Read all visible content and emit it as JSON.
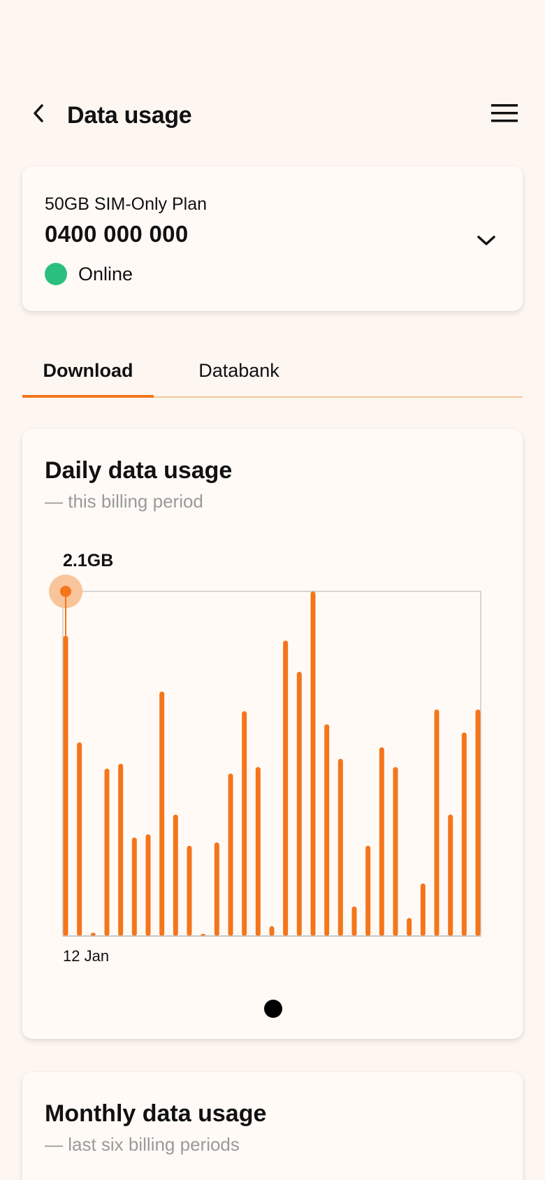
{
  "header": {
    "title": "Data usage",
    "back_icon": "chevron-left-icon",
    "menu_icon": "hamburger-menu-icon"
  },
  "service": {
    "plan": "50GB SIM-Only Plan",
    "number": "0400 000 000",
    "status": "Online",
    "status_color": "#2bbf7e",
    "expand_icon": "chevron-down-icon"
  },
  "tabs": [
    {
      "label": "Download",
      "active": true
    },
    {
      "label": "Databank",
      "active": false
    }
  ],
  "accent_color": "#f5751b",
  "daily": {
    "title": "Daily data usage",
    "subtitle": "— this billing period",
    "selected_value_label": "2.1GB",
    "start_label": "12 Jan"
  },
  "chart_data": {
    "type": "bar",
    "title": "Daily data usage",
    "subtitle": "— this billing period",
    "unit": "GB",
    "x_start_label": "12 Jan",
    "values": [
      1.83,
      1.18,
      0.02,
      1.02,
      1.05,
      0.6,
      0.62,
      1.49,
      0.74,
      0.55,
      0.01,
      0.57,
      0.99,
      1.37,
      1.03,
      0.06,
      1.8,
      1.61,
      2.1,
      1.29,
      1.08,
      0.18,
      0.55,
      1.15,
      1.03,
      0.11,
      0.32,
      1.38,
      0.74,
      1.24,
      1.38
    ],
    "selected_index": 0,
    "selected_label": "2.1GB",
    "ylim": [
      0,
      2.1
    ],
    "grid": false
  },
  "monthly": {
    "title": "Monthly data usage",
    "subtitle": "— last six billing periods"
  }
}
